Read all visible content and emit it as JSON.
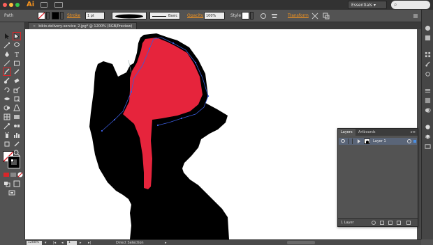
{
  "app": {
    "logo": "Ai"
  },
  "workspace": {
    "label": "Essentials"
  },
  "controlbar": {
    "selection_label": "Path",
    "stroke_label": "Stroke",
    "stroke_weight": "1 pt",
    "brush_label": "Basic",
    "opacity_label": "Opacity",
    "opacity_value": "100%",
    "style_label": "Style",
    "transform_label": "Transform"
  },
  "document": {
    "tab_title": "bikio-delivery-service_2.jpg* @ 1200% (RGB/Preview)"
  },
  "layers_panel": {
    "tabs": [
      "Layers",
      "Artboards"
    ],
    "active_tab": "Layers",
    "rows": [
      {
        "name": "Layer 1",
        "visible": true,
        "color": "#4a8fe2"
      }
    ],
    "footer_count": "1 Layer"
  },
  "statusbar": {
    "zoom": "1200%",
    "artboard": "1",
    "current_tool": "Direct Selection"
  },
  "colors": {
    "canvas": "#ffffff",
    "shape_fill": "#000000",
    "highlight_fill": "#e6243c",
    "path_outline": "#1c2a8c",
    "active_tool_frame": "#d8262a",
    "accent_link": "#f7941d"
  }
}
